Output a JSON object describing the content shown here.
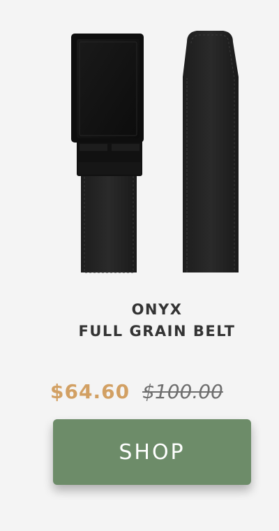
{
  "product": {
    "title_line1": "ONYX",
    "title_line2": "FULL GRAIN BELT",
    "sale_price": "$64.60",
    "original_price": "$100.00",
    "image_icon": "black-belt-with-buckle-image"
  },
  "actions": {
    "shop_label": "SHOP"
  },
  "colors": {
    "background": "#f4f4f4",
    "sale_price": "#d2a063",
    "original_price": "#6e6e6e",
    "button": "#6d8c69",
    "button_text": "#ffffff"
  }
}
